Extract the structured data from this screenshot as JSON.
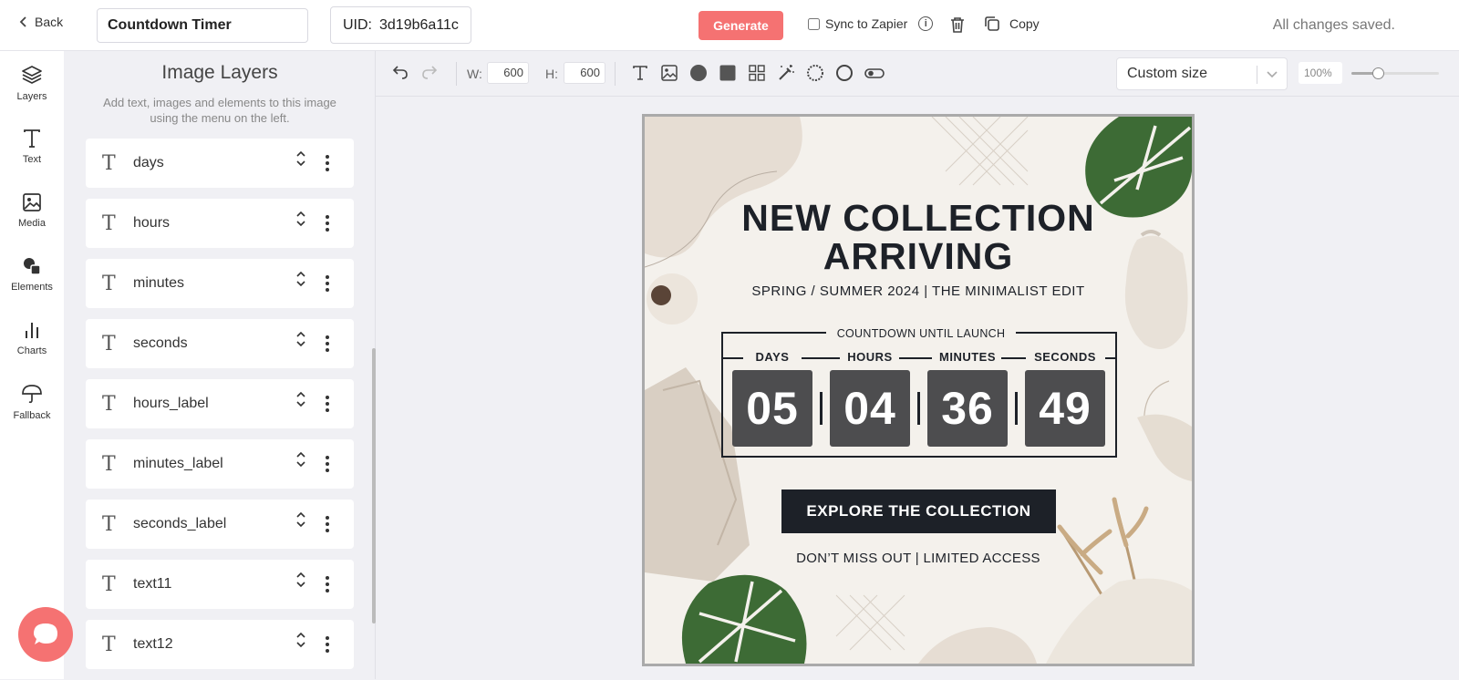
{
  "topbar": {
    "back_label": "Back",
    "template_name": "Countdown Timer",
    "uid_label": "UID:",
    "uid_value": "3d19b6a11c",
    "generate_label": "Generate",
    "sync_label": "Sync to Zapier",
    "info_glyph": "i",
    "copy_label": "Copy",
    "status": "All changes saved."
  },
  "leftnav": {
    "items": [
      {
        "label": "Layers",
        "icon": "layers-icon"
      },
      {
        "label": "Text",
        "icon": "text-icon"
      },
      {
        "label": "Media",
        "icon": "image-icon"
      },
      {
        "label": "Elements",
        "icon": "shapes-icon"
      },
      {
        "label": "Charts",
        "icon": "bar-chart-icon"
      },
      {
        "label": "Fallback",
        "icon": "umbrella-icon"
      }
    ]
  },
  "layers_panel": {
    "title": "Image Layers",
    "subtitle": "Add text, images and elements to this image using the menu on the left.",
    "layer_glyph": "T",
    "layers": [
      "days",
      "hours",
      "minutes",
      "seconds",
      "hours_label",
      "minutes_label",
      "seconds_label",
      "text11",
      "text12"
    ]
  },
  "toolbar": {
    "width_label": "W:",
    "width_value": "600",
    "height_label": "H:",
    "height_value": "600",
    "size_option": "Custom size",
    "zoom_value": "100%",
    "zoom_slider_fraction": 0.3,
    "tools": [
      "text-tool-icon",
      "image-tool-icon",
      "circle-tool-icon",
      "square-tool-icon",
      "grid-tool-icon",
      "magic-wand-icon",
      "ring-tool-icon",
      "outline-circle-icon",
      "toggle-tool-icon"
    ]
  },
  "design": {
    "headline_line1": "NEW COLLECTION",
    "headline_line2": "ARRIVING",
    "tagline": "SPRING / SUMMER 2024 | THE MINIMALIST EDIT",
    "countdown_heading": "COUNTDOWN UNTIL LAUNCH",
    "labels": {
      "days": "DAYS",
      "hours": "HOURS",
      "minutes": "MINUTES",
      "seconds": "SECONDS"
    },
    "values": {
      "days": "05",
      "hours": "04",
      "minutes": "36",
      "seconds": "49"
    },
    "cta_label": "EXPLORE THE COLLECTION",
    "footer": "DON’T MISS OUT | LIMITED ACCESS"
  },
  "colors": {
    "accent": "#f57272",
    "dark": "#1d2128",
    "tile": "#4d4d4f",
    "canvas_bg": "#f4f1ec",
    "leaf": "#3d6b35"
  }
}
